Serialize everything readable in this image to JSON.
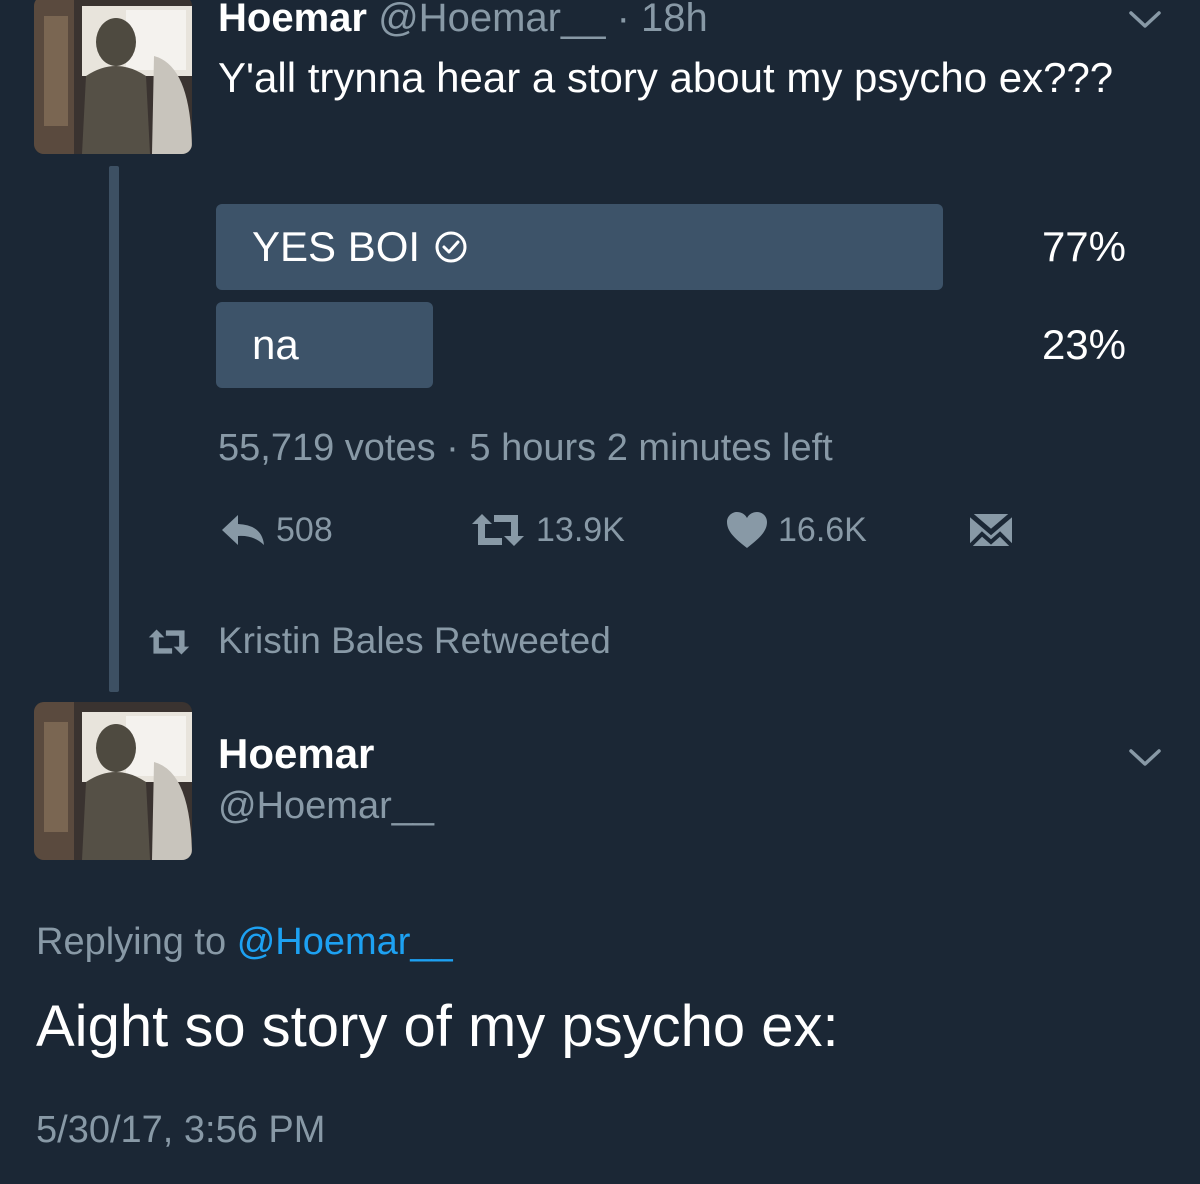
{
  "tweet1": {
    "name": "Hoemar",
    "handle": "@Hoemar__",
    "separator": "·",
    "time": "18h",
    "text": "Y'all trynna hear a story about my psycho ex???",
    "poll": {
      "options": [
        {
          "label": "YES BOI",
          "percent": 77,
          "percent_label": "77%",
          "selected": true
        },
        {
          "label": "na",
          "percent": 23,
          "percent_label": "23%",
          "selected": false
        }
      ],
      "votes": "55,719 votes",
      "meta_separator": "·",
      "time_left": "5 hours 2 minutes left"
    },
    "actions": {
      "reply_count": "508",
      "retweet_count": "13.9K",
      "like_count": "16.6K"
    }
  },
  "retweet_context": {
    "text": "Kristin Bales Retweeted",
    "icon": "retweet-icon"
  },
  "tweet2": {
    "name": "Hoemar",
    "handle": "@Hoemar__",
    "replying_prefix": "Replying to",
    "replying_handle": "@Hoemar__",
    "text": "Aight so story of my psycho ex:",
    "timestamp": "5/30/17, 3:56 PM"
  },
  "icons": {
    "reply": "reply-icon",
    "retweet": "retweet-icon",
    "like": "heart-icon",
    "dm": "envelope-icon",
    "menu": "chevron-down-icon",
    "selected": "check-circle-icon"
  },
  "colors": {
    "background": "#1b2735",
    "poll_bar": "#3d5369",
    "muted_text": "#8899a6",
    "link": "#1da1f2"
  }
}
